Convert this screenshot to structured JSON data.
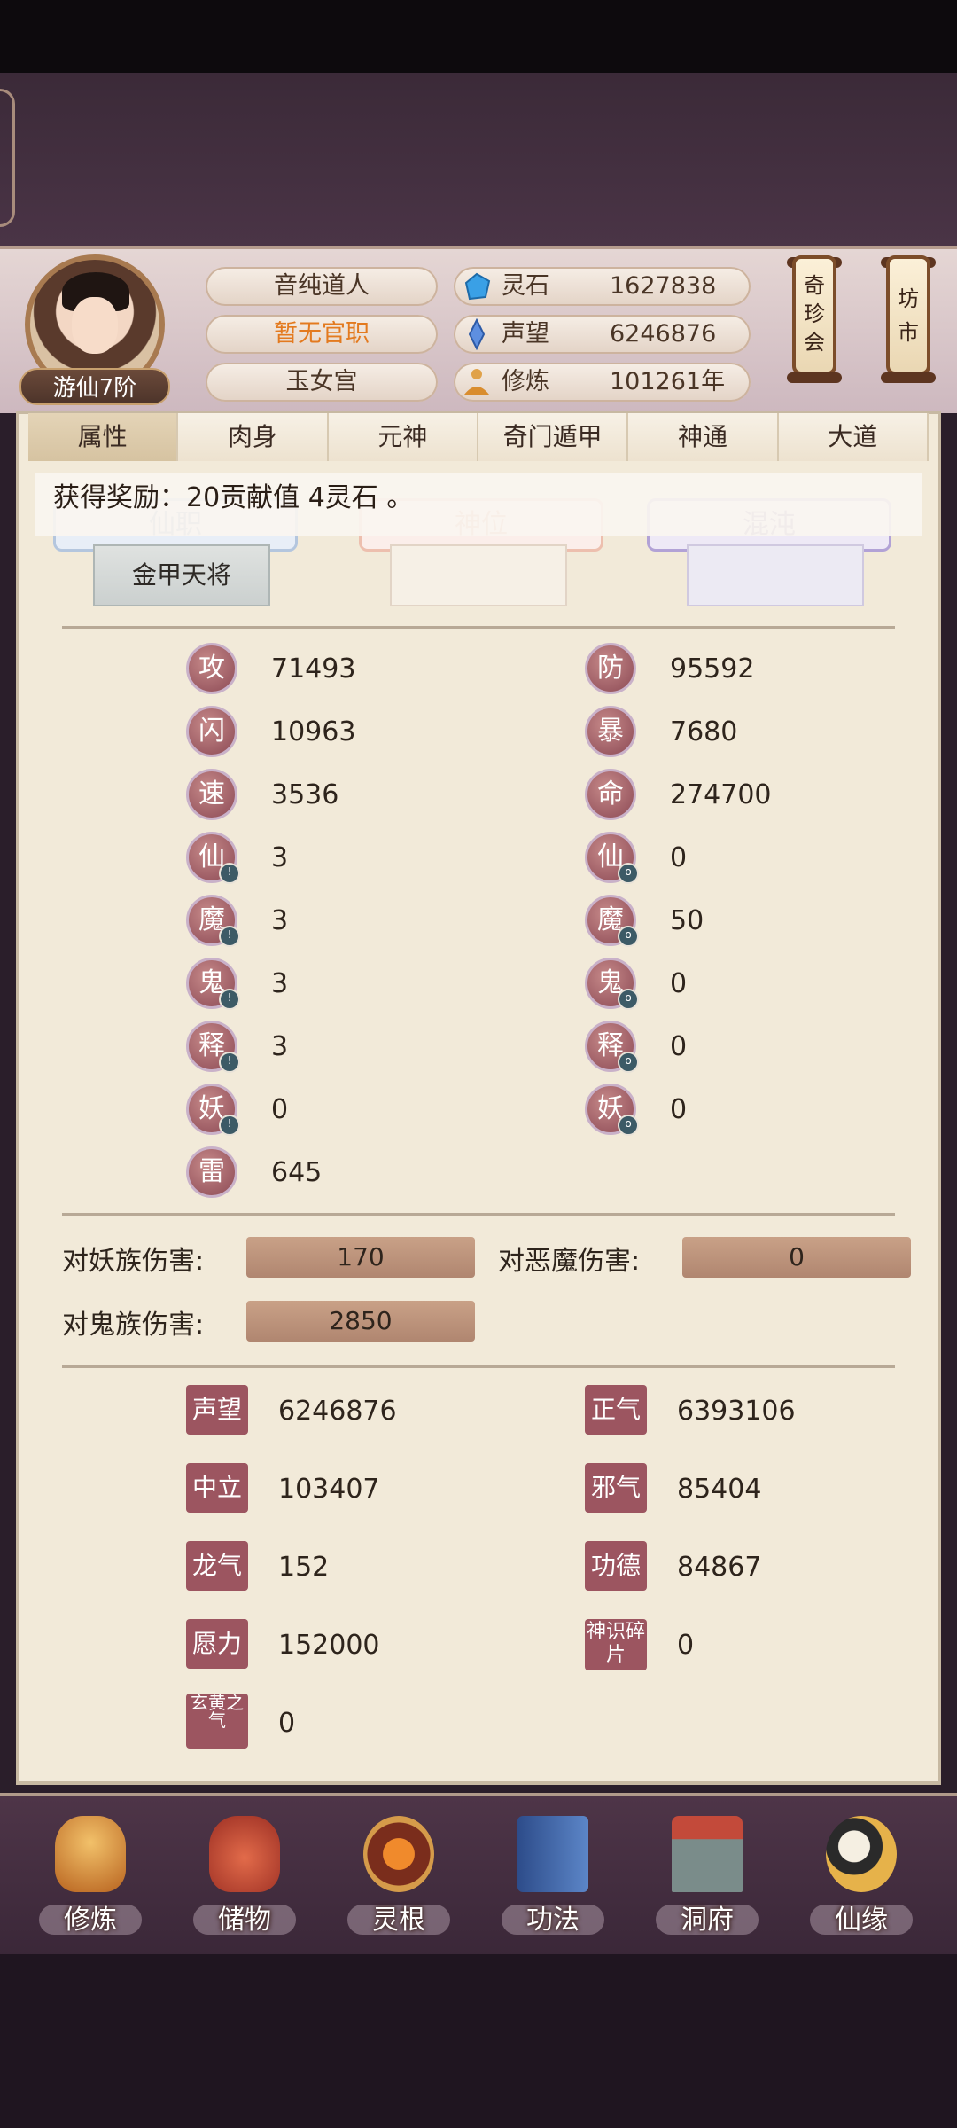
{
  "player": {
    "rank": "游仙7阶",
    "name": "音纯道人",
    "title": "暂无官职",
    "sect": "玉女宫"
  },
  "resources": [
    {
      "label": "灵石",
      "value": "1627838",
      "icon": "spirit-stone-icon"
    },
    {
      "label": "声望",
      "value": "6246876",
      "icon": "prestige-crystal-icon"
    },
    {
      "label": "修炼",
      "value": "101261年",
      "icon": "meditation-icon"
    }
  ],
  "side_buttons": {
    "treasure": "奇珍会",
    "market": "坊市"
  },
  "tabs": [
    "属性",
    "肉身",
    "元神",
    "奇门遁甲",
    "神通",
    "大道"
  ],
  "notice": "获得奖励：20贡献值 4灵石 。",
  "banners": {
    "xian": "仙职",
    "shen": "神位",
    "hundun": "混沌"
  },
  "xian_post": "金甲天将",
  "stats": [
    {
      "sym": "攻",
      "value": "71493"
    },
    {
      "sym": "防",
      "value": "95592"
    },
    {
      "sym": "闪",
      "value": "10963"
    },
    {
      "sym": "暴",
      "value": "7680"
    },
    {
      "sym": "速",
      "value": "3536"
    },
    {
      "sym": "命",
      "value": "274700"
    },
    {
      "sym": "仙",
      "value": "3"
    },
    {
      "sym": "仙",
      "value": "0"
    },
    {
      "sym": "魔",
      "value": "3"
    },
    {
      "sym": "魔",
      "value": "50"
    },
    {
      "sym": "鬼",
      "value": "3"
    },
    {
      "sym": "鬼",
      "value": "0"
    },
    {
      "sym": "释",
      "value": "3"
    },
    {
      "sym": "释",
      "value": "0"
    },
    {
      "sym": "妖",
      "value": "0"
    },
    {
      "sym": "妖",
      "value": "0"
    },
    {
      "sym": "雷",
      "value": "645"
    }
  ],
  "damage": [
    {
      "label": "对妖族伤害:",
      "value": "170"
    },
    {
      "label": "对恶魔伤害:",
      "value": "0"
    },
    {
      "label": "对鬼族伤害:",
      "value": "2850"
    }
  ],
  "reputation": [
    {
      "tag": "声望",
      "value": "6246876"
    },
    {
      "tag": "正气",
      "value": "6393106"
    },
    {
      "tag": "中立",
      "value": "103407"
    },
    {
      "tag": "邪气",
      "value": "85404"
    },
    {
      "tag": "龙气",
      "value": "152"
    },
    {
      "tag": "功德",
      "value": "84867"
    },
    {
      "tag": "愿力",
      "value": "152000"
    },
    {
      "tag": "神识碎片",
      "value": "0"
    },
    {
      "tag": "玄黄之气",
      "value": "0"
    }
  ],
  "nav": [
    {
      "label": "修炼",
      "icon": "cultivate-icon"
    },
    {
      "label": "储物",
      "icon": "storage-bag-icon"
    },
    {
      "label": "灵根",
      "icon": "spirit-root-icon"
    },
    {
      "label": "功法",
      "icon": "technique-book-icon"
    },
    {
      "label": "洞府",
      "icon": "cave-mansion-icon"
    },
    {
      "label": "仙缘",
      "icon": "immortal-fate-icon"
    }
  ]
}
